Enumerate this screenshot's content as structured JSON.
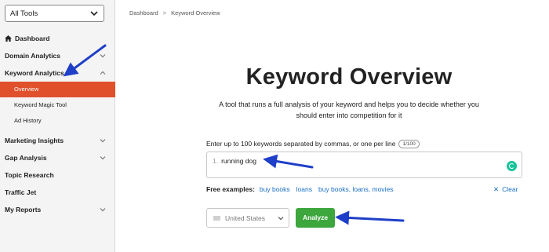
{
  "sidebar": {
    "tool_select": "All Tools",
    "items": [
      {
        "label": "Dashboard"
      },
      {
        "label": "Domain Analytics"
      },
      {
        "label": "Keyword Analytics"
      },
      {
        "label": "Overview"
      },
      {
        "label": "Keyword Magic Tool"
      },
      {
        "label": "Ad History"
      },
      {
        "label": "Marketing Insights"
      },
      {
        "label": "Gap Analysis"
      },
      {
        "label": "Topic Research"
      },
      {
        "label": "Traffic Jet"
      },
      {
        "label": "My Reports"
      }
    ]
  },
  "breadcrumb": {
    "root": "Dashboard",
    "sep": ">",
    "current": "Keyword Overview"
  },
  "main": {
    "title": "Keyword Overview",
    "subtitle": "A tool that runs a full analysis of your keyword and helps you to decide whether you should enter into competition for it",
    "input_label": "Enter up to 100 keywords separated by commas, or one per line",
    "counter": "1/100",
    "keyword_line_number": "1.",
    "keyword_value": "running dog",
    "examples_label": "Free examples:",
    "examples": [
      "buy books",
      "loans",
      "buy books, loans, movies"
    ],
    "clear_label": "Clear",
    "clear_icon": "✕",
    "country_value": "United States",
    "analyze_label": "Analyze"
  },
  "colors": {
    "active_nav_bg": "#e0502b",
    "analyze_bg": "#3da63d",
    "link": "#1a6fc4",
    "annotation_arrow": "#1f3fc8"
  },
  "icons": {
    "dashboard": "home-icon",
    "grammarly": "grammarly-icon",
    "country_flag": "flag-icon"
  }
}
